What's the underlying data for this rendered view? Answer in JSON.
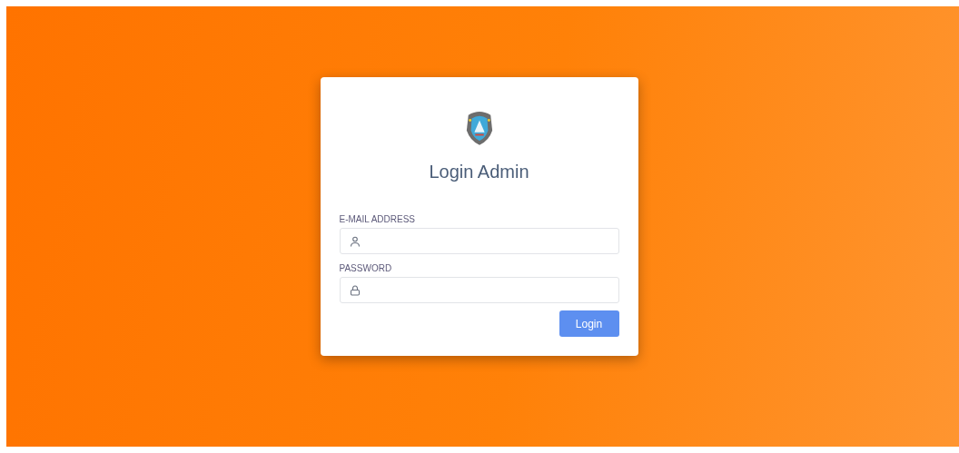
{
  "login_card": {
    "title": "Login Admin",
    "fields": [
      {
        "kind": "email",
        "label": "E-MAIL ADDRESS"
      },
      {
        "kind": "password",
        "label": "PASSWORD"
      }
    ],
    "submit_button": "Login"
  }
}
